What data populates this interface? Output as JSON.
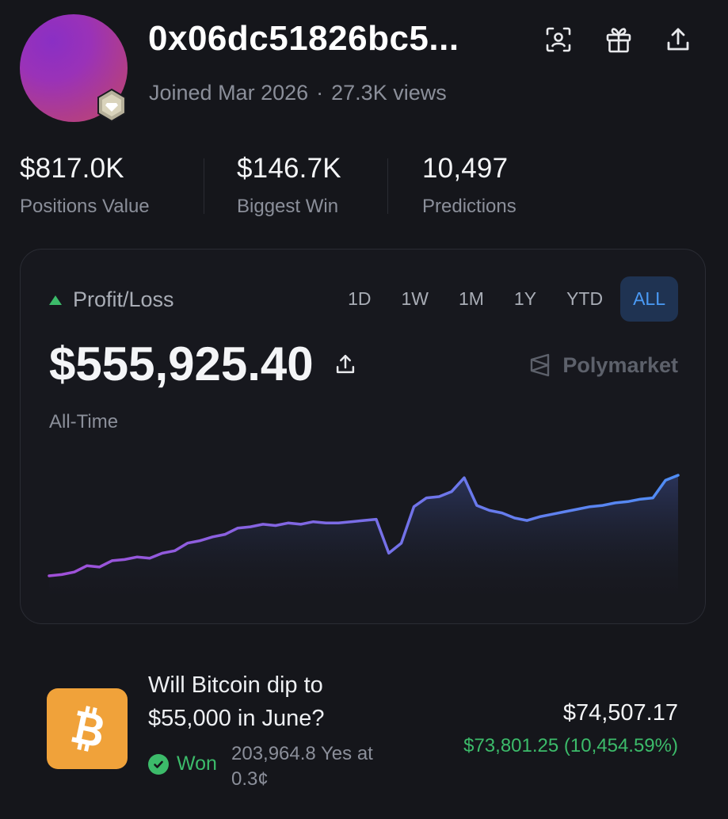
{
  "profile": {
    "username": "0x06dc51826bc5...",
    "joined": "Joined Mar 2026",
    "views": "27.3K views"
  },
  "stats": [
    {
      "value": "$817.0K",
      "label": "Positions Value"
    },
    {
      "value": "$146.7K",
      "label": "Biggest Win"
    },
    {
      "value": "10,497",
      "label": "Predictions"
    }
  ],
  "pnl_card": {
    "label": "Profit/Loss",
    "amount": "$555,925.40",
    "period": "All-Time",
    "brand": "Polymarket",
    "ranges": [
      "1D",
      "1W",
      "1M",
      "1Y",
      "YTD",
      "ALL"
    ],
    "active_range": "ALL"
  },
  "colors": {
    "accent_blue": "#4a9af5",
    "positive_green": "#3cbb6a",
    "line_start": "#a14fd8",
    "line_end": "#4f8df5"
  },
  "chart_data": {
    "type": "line",
    "x": [
      0,
      2,
      4,
      6,
      8,
      10,
      12,
      14,
      16,
      18,
      20,
      22,
      24,
      26,
      28,
      30,
      32,
      34,
      36,
      38,
      40,
      42,
      44,
      46,
      48,
      50,
      52,
      54,
      56,
      58,
      60,
      62,
      64,
      66,
      68,
      70,
      72,
      74,
      76,
      78,
      80,
      82,
      84,
      86,
      88,
      90,
      92,
      94,
      96,
      98,
      100
    ],
    "values": [
      0.0,
      0.01,
      0.03,
      0.08,
      0.07,
      0.12,
      0.13,
      0.15,
      0.14,
      0.18,
      0.2,
      0.26,
      0.28,
      0.31,
      0.33,
      0.38,
      0.39,
      0.41,
      0.4,
      0.42,
      0.41,
      0.43,
      0.42,
      0.42,
      0.43,
      0.44,
      0.45,
      0.18,
      0.26,
      0.55,
      0.62,
      0.63,
      0.67,
      0.78,
      0.56,
      0.52,
      0.5,
      0.46,
      0.44,
      0.47,
      0.49,
      0.51,
      0.53,
      0.55,
      0.56,
      0.58,
      0.59,
      0.61,
      0.62,
      0.76,
      0.8
    ],
    "xlabel": "",
    "ylabel": ""
  },
  "position": {
    "icon": "bitcoin-icon",
    "question": "Will Bitcoin dip to $55,000 in June?",
    "status": "Won",
    "shares": "203,964.8 Yes at 0.3¢",
    "value": "$74,507.17",
    "pnl": "$73,801.25 (10,454.59%)"
  }
}
